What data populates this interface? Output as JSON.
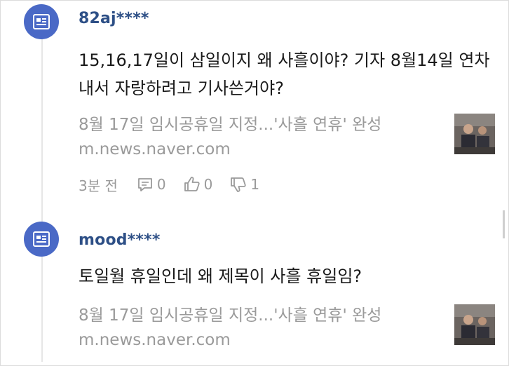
{
  "comments": [
    {
      "username": "82aj****",
      "text": "15,16,17일이 삼일이지 왜 사흘이야? 기자 8월14일 연차내서 자랑하려고 기사쓴거야?",
      "link_title": "8월 17일 임시공휴일 지정...'사흘 연휴' 완성",
      "link_url": "m.news.naver.com",
      "time": "3분 전",
      "reply_count": "0",
      "like_count": "0",
      "dislike_count": "1"
    },
    {
      "username": "mood****",
      "text": "토일월 휴일인데 왜 제목이 사흘 휴일임?",
      "link_title": "8월 17일 임시공휴일 지정...'사흘 연휴' 완성",
      "link_url": "m.news.naver.com"
    }
  ],
  "colors": {
    "avatar_bg": "#4a69c6",
    "username": "#2d4f86",
    "muted_text": "#9a9a9a"
  },
  "icons": {
    "avatar": "news-card-icon",
    "reply": "comment-icon",
    "like": "thumbs-up-icon",
    "dislike": "thumbs-down-icon"
  }
}
